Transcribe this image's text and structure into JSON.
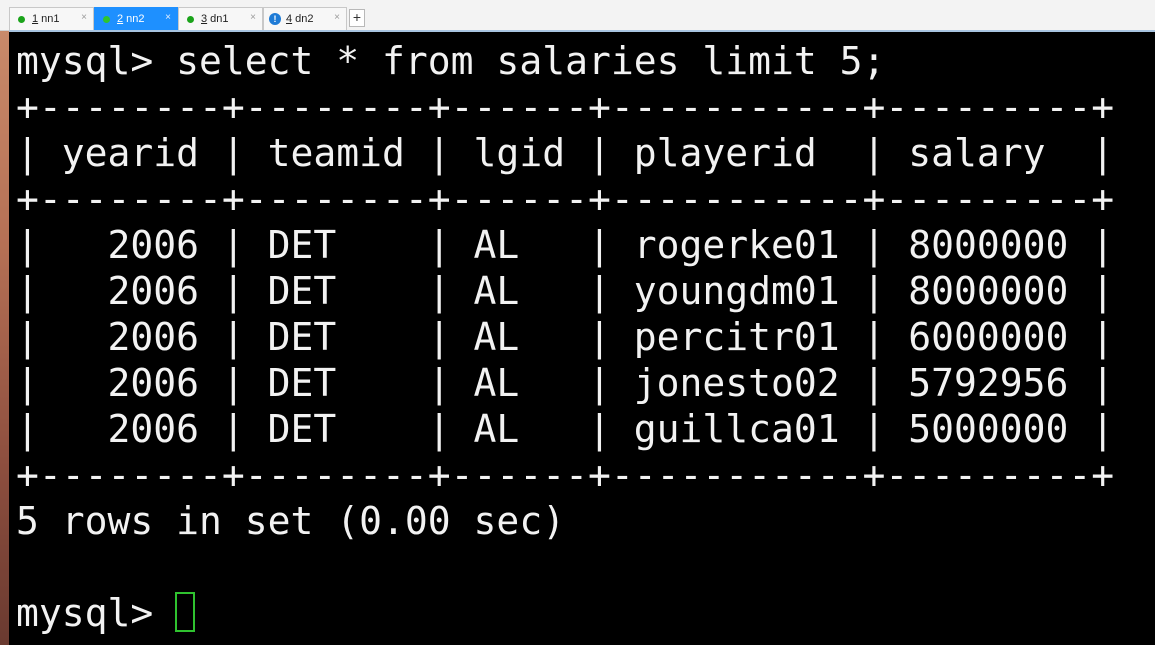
{
  "tabs": [
    {
      "num": "1",
      "label": "nn1",
      "status_color": "#1aa31a",
      "active": false
    },
    {
      "num": "2",
      "label": "nn2",
      "status_color": "#2ec52e",
      "active": true
    },
    {
      "num": "3",
      "label": "dn1",
      "status_color": "#1aa31a",
      "active": false
    },
    {
      "num": "4",
      "label": "dn2",
      "status_color": "#1e7bd6",
      "active": false,
      "warning": "!"
    }
  ],
  "add_tab_label": "+",
  "close_glyph": "×",
  "terminal": {
    "command_line": "mysql> select * from salaries limit 5;",
    "table_border": "+--------+--------+------+-----------+---------+",
    "header_row": "| yearid | teamid | lgid | playerid  | salary  |",
    "rows": [
      "|   2006 | DET    | AL   | rogerke01 | 8000000 |",
      "|   2006 | DET    | AL   | youngdm01 | 8000000 |",
      "|   2006 | DET    | AL   | percitr01 | 6000000 |",
      "|   2006 | DET    | AL   | jonesto02 | 5792956 |",
      "|   2006 | DET    | AL   | guillca01 | 5000000 |"
    ],
    "result_summary": "5 rows in set (0.00 sec)",
    "prompt": "mysql> ",
    "cursor_color": "#2fc22f"
  }
}
